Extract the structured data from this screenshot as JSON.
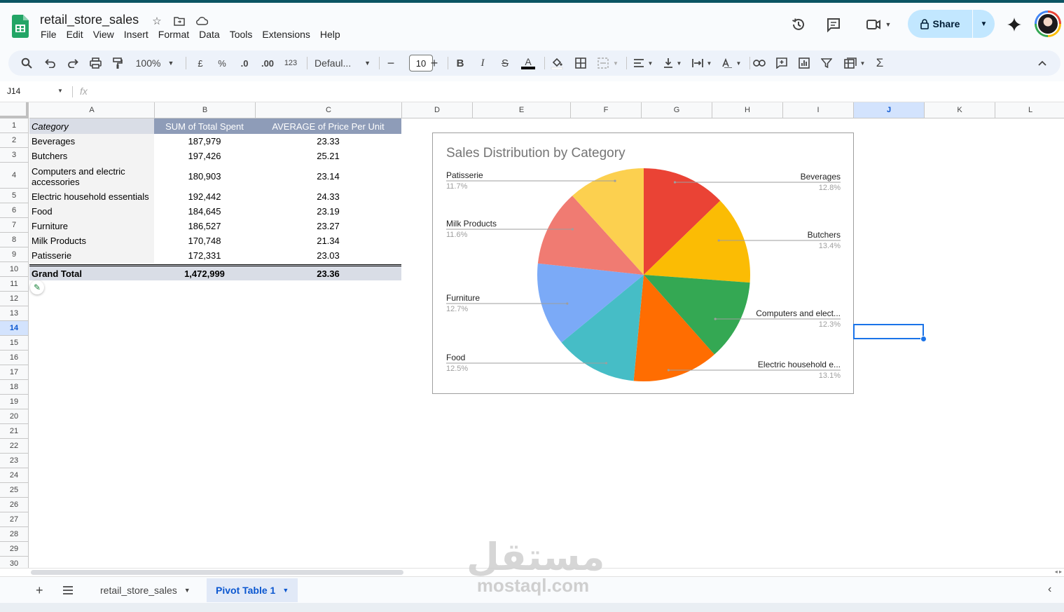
{
  "doc": {
    "title": "retail_store_sales"
  },
  "menu": [
    "File",
    "Edit",
    "View",
    "Insert",
    "Format",
    "Data",
    "Tools",
    "Extensions",
    "Help"
  ],
  "header": {
    "share_label": "Share"
  },
  "toolbar": {
    "zoom": "100%",
    "currency": "£",
    "percent": "%",
    "dec_less": ".0",
    "dec_more": ".00",
    "format_123": "123",
    "font": "Defaul...",
    "font_size": "10"
  },
  "formula_bar": {
    "cell_ref": "J14",
    "fx": "fx"
  },
  "columns": [
    "A",
    "B",
    "C",
    "D",
    "E",
    "F",
    "G",
    "H",
    "I",
    "J",
    "K",
    "L"
  ],
  "selected_column": "J",
  "selected_row": "14",
  "rows": [
    "1",
    "2",
    "3",
    "4",
    "5",
    "6",
    "7",
    "8",
    "9",
    "10",
    "11",
    "12",
    "13",
    "14",
    "15",
    "16",
    "17",
    "18",
    "19",
    "20",
    "21",
    "22",
    "23",
    "24",
    "25",
    "26",
    "27",
    "28",
    "29",
    "30"
  ],
  "pivot": {
    "headers": [
      "Category",
      "SUM of Total Spent",
      "AVERAGE of Price Per Unit"
    ],
    "rows": [
      {
        "category": "Beverages",
        "sum": "187,979",
        "avg": "23.33"
      },
      {
        "category": "Butchers",
        "sum": "197,426",
        "avg": "25.21"
      },
      {
        "category": "Computers and electric accessories",
        "sum": "180,903",
        "avg": "23.14"
      },
      {
        "category": "Electric household essentials",
        "sum": "192,442",
        "avg": "24.33"
      },
      {
        "category": "Food",
        "sum": "184,645",
        "avg": "23.19"
      },
      {
        "category": "Furniture",
        "sum": "186,527",
        "avg": "23.27"
      },
      {
        "category": "Milk Products",
        "sum": "170,748",
        "avg": "21.34"
      },
      {
        "category": "Patisserie",
        "sum": "172,331",
        "avg": "23.03"
      }
    ],
    "total": {
      "label": "Grand Total",
      "sum": "1,472,999",
      "avg": "23.36"
    }
  },
  "chart_data": {
    "type": "pie",
    "title": "Sales Distribution by Category",
    "legend": "none",
    "slices": [
      {
        "label": "Beverages",
        "pct_label": "12.8%",
        "value": 187979,
        "color": "#ea4335"
      },
      {
        "label": "Butchers",
        "pct_label": "13.4%",
        "value": 197426,
        "color": "#fbbc04"
      },
      {
        "label": "Computers and elect...",
        "pct_label": "12.3%",
        "value": 180903,
        "color": "#34a853"
      },
      {
        "label": "Electric household e...",
        "pct_label": "13.1%",
        "value": 192442,
        "color": "#ff6d01"
      },
      {
        "label": "Food",
        "pct_label": "12.5%",
        "value": 184645,
        "color": "#46bdc6"
      },
      {
        "label": "Furniture",
        "pct_label": "12.7%",
        "value": 186527,
        "color": "#7baaf7"
      },
      {
        "label": "Milk Products",
        "pct_label": "11.6%",
        "value": 170748,
        "color": "#f07b72"
      },
      {
        "label": "Patisserie",
        "pct_label": "11.7%",
        "value": 172331,
        "color": "#fcd04f"
      }
    ]
  },
  "sheets": [
    {
      "name": "retail_store_sales",
      "active": false
    },
    {
      "name": "Pivot Table 1",
      "active": true
    }
  ],
  "watermark": {
    "arabic": "مستقل",
    "latin": "mostaql.com"
  }
}
